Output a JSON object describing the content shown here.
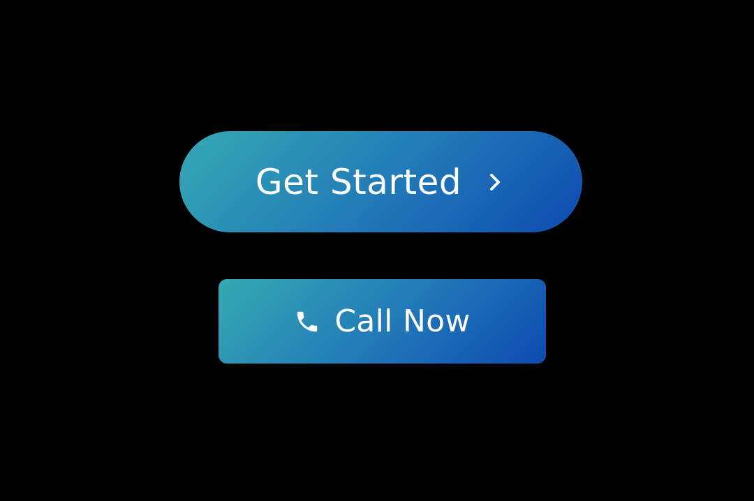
{
  "colors": {
    "background": "#000000",
    "gradient_start": "#35aab3",
    "gradient_mid": "#2177b7",
    "gradient_end": "#0d4ab0",
    "text": "#ffffff"
  },
  "primary_button": {
    "label": "Get Started",
    "icon": "chevron-right-icon"
  },
  "secondary_button": {
    "label": "Call Now",
    "icon": "phone-icon"
  }
}
